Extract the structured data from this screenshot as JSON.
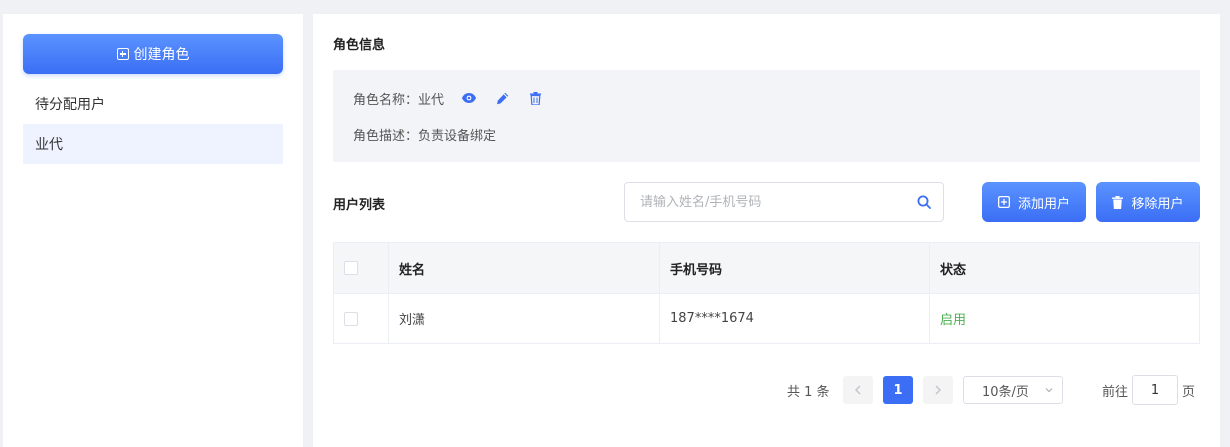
{
  "sidebar": {
    "create_label": "创建角色",
    "items": [
      {
        "label": "待分配用户",
        "active": false
      },
      {
        "label": "业代",
        "active": true
      }
    ]
  },
  "role_info": {
    "section_title": "角色信息",
    "name_label": "角色名称：",
    "name_value": "业代",
    "desc_label": "角色描述：",
    "desc_value": "负责设备绑定",
    "actions": [
      "eye-icon",
      "edit-icon",
      "delete-icon"
    ]
  },
  "user_list": {
    "section_title": "用户列表",
    "search_placeholder": "请输入姓名/手机号码",
    "add_label": "添加用户",
    "remove_label": "移除用户",
    "columns": [
      "姓名",
      "手机号码",
      "状态"
    ],
    "rows": [
      {
        "name": "刘潇",
        "phone": "187****1674",
        "status": "启用"
      }
    ]
  },
  "pagination": {
    "total_text": "共 1 条",
    "current_page": "1",
    "page_size": "10条/页",
    "goto_label": "前往",
    "goto_value": "1",
    "goto_unit": "页"
  },
  "colors": {
    "primary": "#3b6ef5",
    "status_enabled": "#4caf50",
    "active_item_bg": "#eef3ff"
  }
}
